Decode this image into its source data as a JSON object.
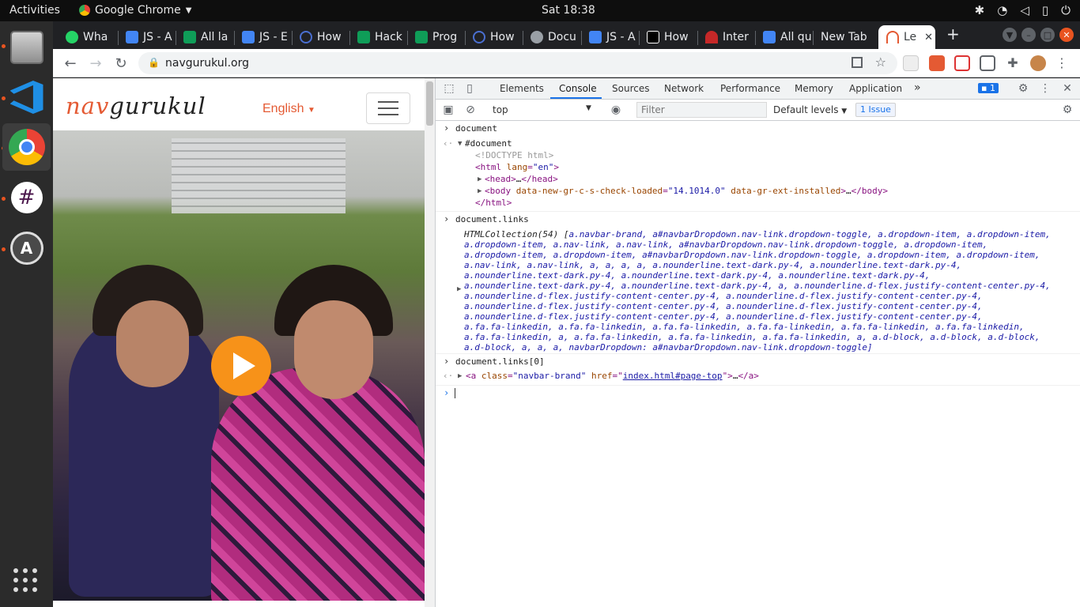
{
  "topbar": {
    "activities": "Activities",
    "app_name": "Google Chrome",
    "clock": "Sat 18:38"
  },
  "tabs": [
    {
      "label": "Wha",
      "color": "#25d366"
    },
    {
      "label": "JS - A",
      "color": "#4285f4"
    },
    {
      "label": "All la",
      "color": "#0f9d58"
    },
    {
      "label": "JS - E",
      "color": "#4285f4"
    },
    {
      "label": "How",
      "color": "#4a6fd1"
    },
    {
      "label": "Hack",
      "color": "#0f9d58"
    },
    {
      "label": "Prog",
      "color": "#0f9d58"
    },
    {
      "label": "How",
      "color": "#4a6fd1"
    },
    {
      "label": "Docu",
      "color": "#9aa0a6"
    },
    {
      "label": "JS - A",
      "color": "#4285f4"
    },
    {
      "label": "How",
      "color": "#000000"
    },
    {
      "label": "Inter",
      "color": "#c62828"
    },
    {
      "label": "All qu",
      "color": "#4285f4"
    },
    {
      "label": "New Tab",
      "color": ""
    },
    {
      "label": "Le",
      "color": "#e45a33"
    }
  ],
  "new_tab_symbol": "+",
  "address_bar": {
    "url": "navgurukul.org"
  },
  "site": {
    "brand_part1": "nav",
    "brand_part2": "gurukul",
    "language": "English"
  },
  "devtools": {
    "tabs": [
      "Elements",
      "Console",
      "Sources",
      "Network",
      "Performance",
      "Memory",
      "Application"
    ],
    "active_tab": "Console",
    "more_tabs": "»",
    "issues_badge": "1",
    "context": "top",
    "filter_placeholder": "Filter",
    "levels": "Default levels",
    "issue_chip": "1 Issue"
  },
  "console": {
    "cmd1": "document",
    "doc_root": "#document",
    "doctype": "<!DOCTYPE html>",
    "html_open_tag": "html",
    "html_lang_attr": "lang",
    "html_lang_val": "\"en\"",
    "head_line": "…",
    "body_attr1": "data-new-gr-c-s-check-loaded",
    "body_val1": "\"14.1014.0\"",
    "body_attr2": "data-gr-ext-installed",
    "html_close": "</html>",
    "cmd2": "document.links",
    "collection_lines": [
      "HTMLCollection(54) [a.navbar-brand, a#navbarDropdown.nav-link.dropdown-toggle, a.dropdown-item, a.dropdown-item,",
      "a.dropdown-item, a.nav-link, a.nav-link, a#navbarDropdown.nav-link.dropdown-toggle, a.dropdown-item,",
      "a.dropdown-item, a.dropdown-item, a#navbarDropdown.nav-link.dropdown-toggle, a.dropdown-item, a.dropdown-item,",
      "a.nav-link, a.nav-link, a, a, a, a, a.nounderline.text-dark.py-4, a.nounderline.text-dark.py-4,",
      "a.nounderline.text-dark.py-4, a.nounderline.text-dark.py-4, a.nounderline.text-dark.py-4,",
      "a.nounderline.text-dark.py-4, a.nounderline.text-dark.py-4, a, a.nounderline.d-flex.justify-content-center.py-4,",
      "a.nounderline.d-flex.justify-content-center.py-4, a.nounderline.d-flex.justify-content-center.py-4,",
      "a.nounderline.d-flex.justify-content-center.py-4, a.nounderline.d-flex.justify-content-center.py-4,",
      "a.nounderline.d-flex.justify-content-center.py-4, a.nounderline.d-flex.justify-content-center.py-4,",
      "a.fa.fa-linkedin, a.fa.fa-linkedin, a.fa.fa-linkedin, a.fa.fa-linkedin, a.fa.fa-linkedin, a.fa.fa-linkedin,",
      "a.fa.fa-linkedin, a, a.fa.fa-linkedin, a.fa.fa-linkedin, a.fa.fa-linkedin, a, a.d-block, a.d-block, a.d-block,",
      "a.d-block, a, a, a, navbarDropdown: a#navbarDropdown.nav-link.dropdown-toggle]"
    ],
    "cmd3": "document.links[0]",
    "anchor_tag": "a",
    "anchor_class_attr": "class",
    "anchor_class_val": "\"navbar-brand\"",
    "anchor_href_attr": "href",
    "anchor_href_val": "index.html#page-top",
    "anchor_tail": "…"
  }
}
